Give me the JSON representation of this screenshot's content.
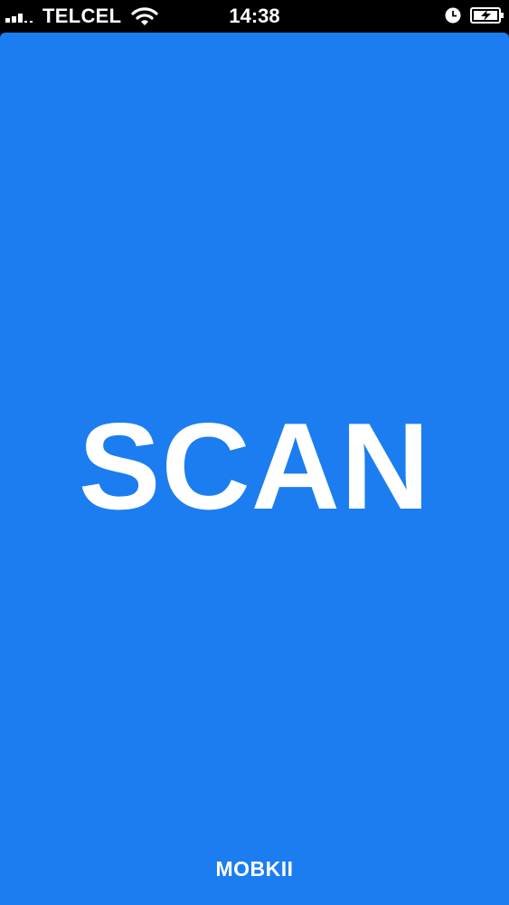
{
  "status_bar": {
    "carrier": "TELCEL",
    "time": "14:38",
    "icons": [
      "signal-bars-icon",
      "wifi-icon",
      "clock-icon",
      "battery-charging-icon"
    ]
  },
  "splash": {
    "title": "SCAN",
    "brand": "MOBKII",
    "colors": {
      "background": "#1b7df0",
      "text": "#ffffff",
      "status_bar": "#000000"
    }
  }
}
